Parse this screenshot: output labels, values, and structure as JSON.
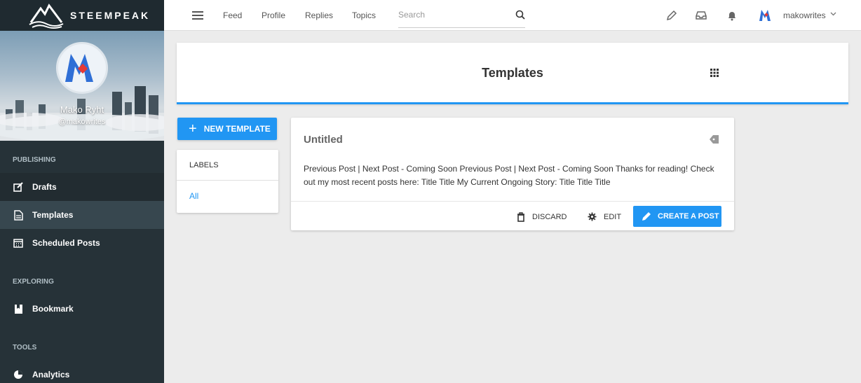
{
  "brand": {
    "name": "STEEMPEAK"
  },
  "profile": {
    "display_name": "Mako Ryht",
    "handle": "@makowrites"
  },
  "sidebar": {
    "sections": [
      {
        "title": "PUBLISHING",
        "items": [
          {
            "label": "Drafts",
            "icon": "edit-icon"
          },
          {
            "label": "Templates",
            "icon": "document-icon",
            "active": true
          },
          {
            "label": "Scheduled Posts",
            "icon": "calendar-icon"
          }
        ]
      },
      {
        "title": "EXPLORING",
        "items": [
          {
            "label": "Bookmark",
            "icon": "bookmark-icon"
          }
        ]
      },
      {
        "title": "TOOLS",
        "items": [
          {
            "label": "Analytics",
            "icon": "pie-chart-icon"
          }
        ]
      }
    ]
  },
  "topbar": {
    "links": [
      "Feed",
      "Profile",
      "Replies",
      "Topics"
    ],
    "search_placeholder": "Search",
    "username": "makowrites"
  },
  "header": {
    "title": "Templates"
  },
  "new_template_label": "NEW TEMPLATE",
  "labels_panel": {
    "title": "LABELS",
    "items": [
      "All"
    ]
  },
  "template": {
    "title": "Untitled",
    "body": "Previous Post | Next Post - Coming Soon Previous Post | Next Post - Coming Soon Thanks for reading! Check out my most recent posts here: Title Title My Current Ongoing Story: Title Title Title",
    "discard_label": "DISCARD",
    "edit_label": "EDIT",
    "create_label": "CREATE A POST"
  },
  "colors": {
    "accent": "#2196f3",
    "sidebar": "#263238",
    "sidebar_active": "#37474f",
    "logo_red": "#e53935",
    "logo_blue": "#2f6fd6"
  }
}
